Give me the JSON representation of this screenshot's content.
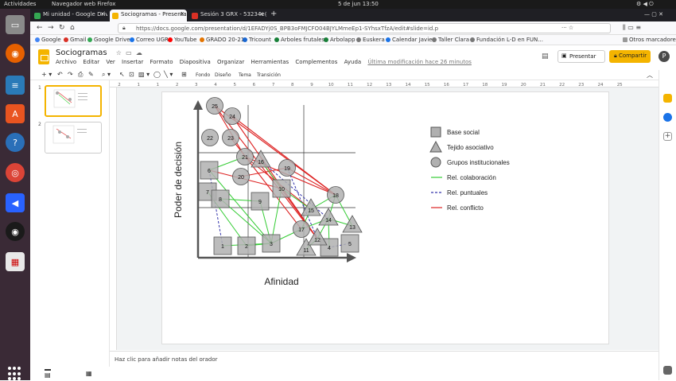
{
  "os": {
    "activities": "Actividades",
    "browser_name": "Navegador web Firefox",
    "clock": "5 de jun  13:50"
  },
  "tabs": [
    {
      "label": "Mi unidad - Google Drive",
      "color": "#34a853"
    },
    {
      "label": "Sociogramas - Presentac",
      "color": "#f4b400"
    },
    {
      "label": "Sesión 3 GRX - 53234e@",
      "color": "#d93025"
    }
  ],
  "url": "https://docs.google.com/presentation/d/1EFADYj0S_BPB3oFMJCFO04BJYLMmeEp1-SYhsxTfzA/edit#slide=id.p",
  "bookmarks": [
    {
      "label": "Google",
      "color": "#4285f4"
    },
    {
      "label": "Gmail",
      "color": "#d93025"
    },
    {
      "label": "Google Drive",
      "color": "#34a853"
    },
    {
      "label": "Correo UGR",
      "color": "#1a73e8"
    },
    {
      "label": "YouTube",
      "color": "#ff0000"
    },
    {
      "label": "GRADO 20-21",
      "color": "#e37400"
    },
    {
      "label": "Tricount",
      "color": "#1967d2"
    },
    {
      "label": "Arboles frutales",
      "color": "#188038"
    },
    {
      "label": "Arbolapp",
      "color": "#188038"
    },
    {
      "label": "Euskera",
      "color": "#777777"
    },
    {
      "label": "Calendar Javier",
      "color": "#1a73e8"
    },
    {
      "label": "Taller Clara",
      "color": "#777777"
    },
    {
      "label": "Fundación L-D en FUN...",
      "color": "#777777"
    }
  ],
  "other_bookmarks": "Otros marcadores",
  "doc": {
    "title": "Sociogramas",
    "menus": [
      "Archivo",
      "Editar",
      "Ver",
      "Insertar",
      "Formato",
      "Diapositiva",
      "Organizar",
      "Herramientas",
      "Complementos",
      "Ayuda"
    ],
    "last_edit": "Última modificación hace 26 minutos",
    "present": "Presentar",
    "share": "Compartir",
    "avatar": "P"
  },
  "toolbar": {
    "fondo": "Fondo",
    "diseno": "Diseño",
    "tema": "Tema",
    "transicion": "Transición"
  },
  "ruler_numbers": [
    "2",
    "1",
    "1",
    "2",
    "3",
    "4",
    "5",
    "6",
    "7",
    "8",
    "9",
    "10",
    "11",
    "12",
    "13",
    "14",
    "15",
    "16",
    "17",
    "18",
    "19",
    "20",
    "21",
    "22",
    "23",
    "24",
    "25"
  ],
  "slide_numbers": [
    "1",
    "2"
  ],
  "notes_placeholder": "Haz clic para añadir notas del orador",
  "chart": {
    "ylabel": "Poder de decisión",
    "xlabel": "Afinidad",
    "legend": [
      {
        "label": "Base social",
        "shape": "square"
      },
      {
        "label": "Tejido asociativo",
        "shape": "triangle"
      },
      {
        "label": "Grupos institucionales",
        "shape": "circle"
      },
      {
        "label": "Rel. colaboración",
        "shape": "line",
        "color": "#33cc33",
        "dash": false
      },
      {
        "label": "Rel. puntuales",
        "shape": "line",
        "color": "#3333aa",
        "dash": true
      },
      {
        "label": "Rel. conflicto",
        "shape": "line",
        "color": "#dd2222",
        "dash": false
      }
    ],
    "nodes": [
      {
        "id": "1",
        "shape": "square"
      },
      {
        "id": "2",
        "shape": "square"
      },
      {
        "id": "3",
        "shape": "square"
      },
      {
        "id": "4",
        "shape": "square"
      },
      {
        "id": "5",
        "shape": "square"
      },
      {
        "id": "6",
        "shape": "square"
      },
      {
        "id": "7",
        "shape": "square"
      },
      {
        "id": "8",
        "shape": "square"
      },
      {
        "id": "9",
        "shape": "square"
      },
      {
        "id": "10",
        "shape": "square"
      },
      {
        "id": "11",
        "shape": "triangle"
      },
      {
        "id": "12",
        "shape": "triangle"
      },
      {
        "id": "13",
        "shape": "triangle"
      },
      {
        "id": "14",
        "shape": "triangle"
      },
      {
        "id": "15",
        "shape": "triangle"
      },
      {
        "id": "16",
        "shape": "triangle"
      },
      {
        "id": "17",
        "shape": "circle"
      },
      {
        "id": "18",
        "shape": "circle"
      },
      {
        "id": "19",
        "shape": "circle"
      },
      {
        "id": "20",
        "shape": "circle"
      },
      {
        "id": "21",
        "shape": "circle"
      },
      {
        "id": "22",
        "shape": "circle"
      },
      {
        "id": "23",
        "shape": "circle"
      },
      {
        "id": "24",
        "shape": "circle"
      },
      {
        "id": "25",
        "shape": "circle"
      }
    ],
    "edges": [
      {
        "from": "25",
        "to": "18",
        "type": "conflict"
      },
      {
        "from": "25",
        "to": "12",
        "type": "conflict"
      },
      {
        "from": "24",
        "to": "18",
        "type": "conflict"
      },
      {
        "from": "24",
        "to": "12",
        "type": "conflict"
      },
      {
        "from": "23",
        "to": "17",
        "type": "conflict"
      },
      {
        "from": "21",
        "to": "18",
        "type": "conflict"
      },
      {
        "from": "21",
        "to": "15",
        "type": "conflict"
      },
      {
        "from": "6",
        "to": "10",
        "type": "conflict"
      },
      {
        "from": "20",
        "to": "19",
        "type": "conflict"
      },
      {
        "from": "16",
        "to": "12",
        "type": "conflict"
      },
      {
        "from": "25",
        "to": "21",
        "type": "conflict"
      },
      {
        "from": "19",
        "to": "18",
        "type": "conflict"
      },
      {
        "from": "6",
        "to": "1",
        "type": "punctual"
      },
      {
        "from": "19",
        "to": "12",
        "type": "punctual"
      },
      {
        "from": "16",
        "to": "14",
        "type": "punctual"
      },
      {
        "from": "5",
        "to": "4",
        "type": "punctual"
      },
      {
        "from": "6",
        "to": "3",
        "type": "collab"
      },
      {
        "from": "7",
        "to": "2",
        "type": "collab"
      },
      {
        "from": "8",
        "to": "3",
        "type": "collab"
      },
      {
        "from": "9",
        "to": "3",
        "type": "collab"
      },
      {
        "from": "10",
        "to": "3",
        "type": "collab"
      },
      {
        "from": "10",
        "to": "15",
        "type": "collab"
      },
      {
        "from": "2",
        "to": "3",
        "type": "collab"
      },
      {
        "from": "3",
        "to": "17",
        "type": "collab"
      },
      {
        "from": "17",
        "to": "15",
        "type": "collab"
      },
      {
        "from": "17",
        "to": "14",
        "type": "collab"
      },
      {
        "from": "15",
        "to": "18",
        "type": "collab"
      },
      {
        "from": "14",
        "to": "18",
        "type": "collab"
      },
      {
        "from": "14",
        "to": "13",
        "type": "collab"
      },
      {
        "from": "4",
        "to": "14",
        "type": "collab"
      },
      {
        "from": "12",
        "to": "11",
        "type": "collab"
      },
      {
        "from": "12",
        "to": "14",
        "type": "collab"
      },
      {
        "from": "21",
        "to": "6",
        "type": "collab"
      },
      {
        "from": "16",
        "to": "10",
        "type": "collab"
      },
      {
        "from": "18",
        "to": "13",
        "type": "collab"
      },
      {
        "from": "1",
        "to": "3",
        "type": "collab"
      },
      {
        "from": "8",
        "to": "9",
        "type": "collab"
      }
    ],
    "colors": {
      "conflict": "#dd2222",
      "punctual": "#3333aa",
      "collab": "#33cc33",
      "node_fill": "#b0b0b0",
      "node_stroke": "#555555"
    }
  }
}
